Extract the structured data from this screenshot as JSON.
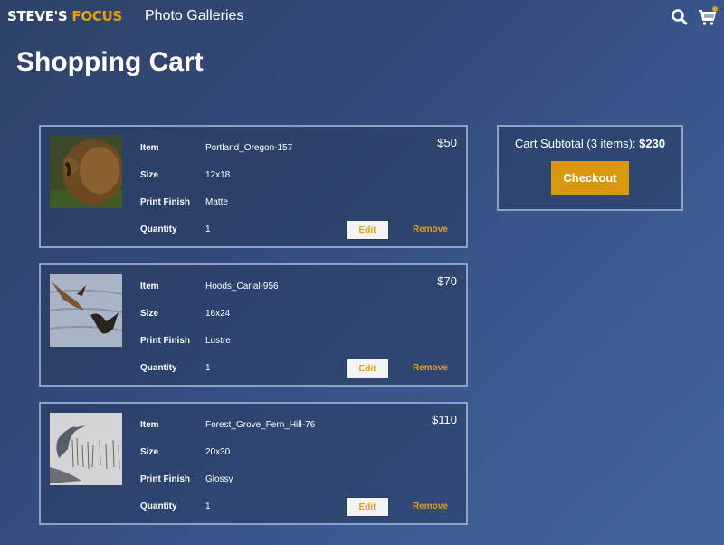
{
  "header": {
    "logo_part1": "STEVE'S",
    "logo_part2": "FOCUS",
    "nav_link": "Photo Galleries",
    "icons": [
      "search-icon",
      "shopping-cart-icon"
    ],
    "accent_color": "#e39f12"
  },
  "page_title": "Shopping Cart",
  "labels": {
    "item": "Item",
    "size": "Size",
    "finish": "Print Finish",
    "quantity": "Quantity",
    "edit": "Edit",
    "remove": "Remove"
  },
  "items": [
    {
      "name": "Portland_Oregon-157",
      "size": "12x18",
      "finish": "Matte",
      "quantity": "1",
      "price": "$50",
      "thumb": "lion"
    },
    {
      "name": "Hoods_Canal-956",
      "size": "16x24",
      "finish": "Lustre",
      "quantity": "1",
      "price": "$70",
      "thumb": "eagles"
    },
    {
      "name": "Forest_Grove_Fern_Hill-76",
      "size": "20x30",
      "finish": "Glossy",
      "quantity": "1",
      "price": "$110",
      "thumb": "heron"
    }
  ],
  "summary": {
    "subtotal_label": "Cart Subtotal (3 items):",
    "subtotal_value": "$230",
    "checkout_label": "Checkout"
  }
}
